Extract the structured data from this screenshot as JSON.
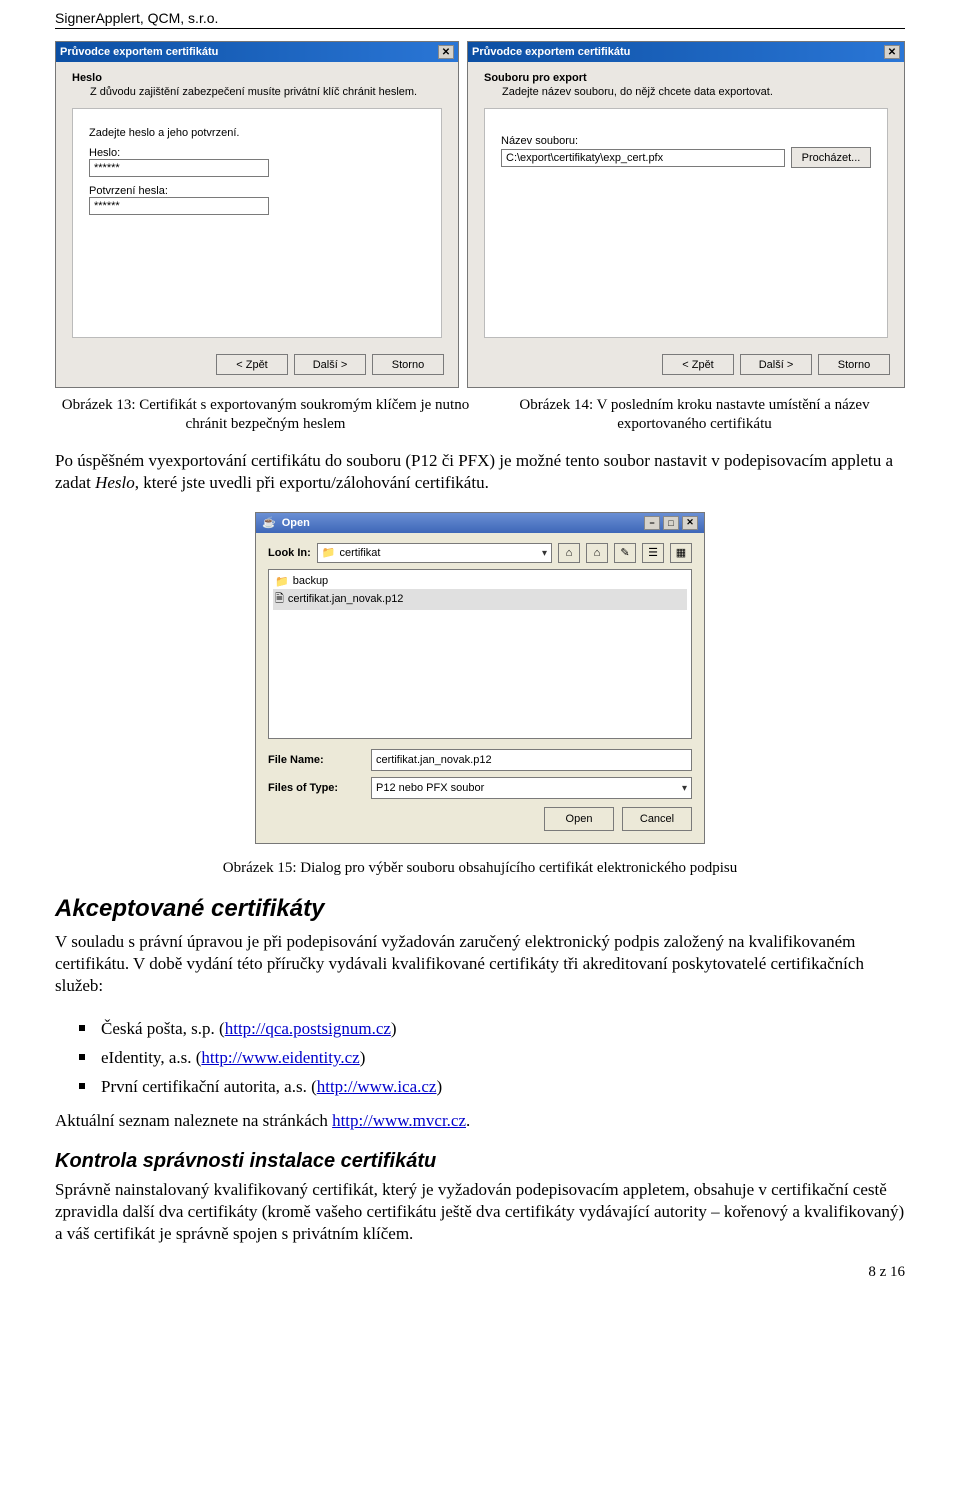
{
  "header": "SignerApplert, QCM, s.r.o.",
  "dialog1": {
    "title": "Průvodce exportem certifikátu",
    "section_title": "Heslo",
    "section_sub": "Z důvodu zajištění zabezpečení musíte privátní klíč chránit heslem.",
    "prompt": "Zadejte heslo a jeho potvrzení.",
    "label_pass": "Heslo:",
    "value_pass": "******",
    "label_confirm": "Potvrzení hesla:",
    "value_confirm": "******",
    "btn_back": "< Zpět",
    "btn_next": "Další >",
    "btn_cancel": "Storno"
  },
  "dialog2": {
    "title": "Průvodce exportem certifikátu",
    "section_title": "Souboru pro export",
    "section_sub": "Zadejte název souboru, do nějž chcete data exportovat.",
    "label_file": "Název souboru:",
    "value_file": "C:\\export\\certifikaty\\exp_cert.pfx",
    "btn_browse": "Procházet...",
    "btn_back": "< Zpět",
    "btn_next": "Další >",
    "btn_cancel": "Storno"
  },
  "caption13": "Obrázek 13: Certifikát s exportovaným soukromým klíčem je nutno chránit bezpečným heslem",
  "caption14": "Obrázek 14: V posledním kroku nastavte umístění a název exportovaného certifikátu",
  "para1_a": "Po úspěšném vyexportování certifikátu do souboru (P12 či PFX) je možné tento soubor nastavit v podepisovacím appletu a zadat ",
  "para1_em": "Heslo",
  "para1_b": ", které jste uvedli při exportu/zálohování certifikátu.",
  "open_dialog": {
    "title": "Open",
    "label_lookin": "Look In:",
    "lookin_value": "certifikat",
    "items": {
      "backup": "backup",
      "cert": "certifikat.jan_novak.p12"
    },
    "label_filename": "File Name:",
    "value_filename": "certifikat.jan_novak.p12",
    "label_filetype": "Files of Type:",
    "value_filetype": "P12 nebo PFX soubor",
    "btn_open": "Open",
    "btn_cancel": "Cancel"
  },
  "caption15": "Obrázek 15: Dialog pro výběr souboru obsahujícího certifikát elektronického podpisu",
  "sec_title": "Akceptované certifikáty",
  "para2": "V souladu s právní úpravou je při podepisování vyžadován zaručený elektronický podpis založený na kvalifikovaném certifikátu. V době vydání této příručky vydávali kvalifikované certifikáty tři akreditovaní poskytovatelé certifikačních služeb:",
  "bullets": {
    "b1a": "Česká pošta, s.p. (",
    "b1link": "http://qca.postsignum.cz",
    "b1b": ")",
    "b2a": "eIdentity, a.s. (",
    "b2link": "http://www.eidentity.cz",
    "b2b": ")",
    "b3a": "První certifikační autorita, a.s. (",
    "b3link": "http://www.ica.cz",
    "b3b": ")"
  },
  "para3a": "Aktuální seznam naleznete na stránkách ",
  "para3link": "http://www.mvcr.cz",
  "para3b": ".",
  "sub_title": "Kontrola správnosti instalace certifikátu",
  "para4": "Správně nainstalovaný kvalifikovaný certifikát, který je vyžadován podepisovacím appletem, obsahuje v certifikační cestě zpravidla další dva certifikáty (kromě vašeho certifikátu ještě dva certifikáty vydávající autority – kořenový a kvalifikovaný) a váš certifikát je správně spojen s privátním klíčem.",
  "page_num": "8 z 16"
}
